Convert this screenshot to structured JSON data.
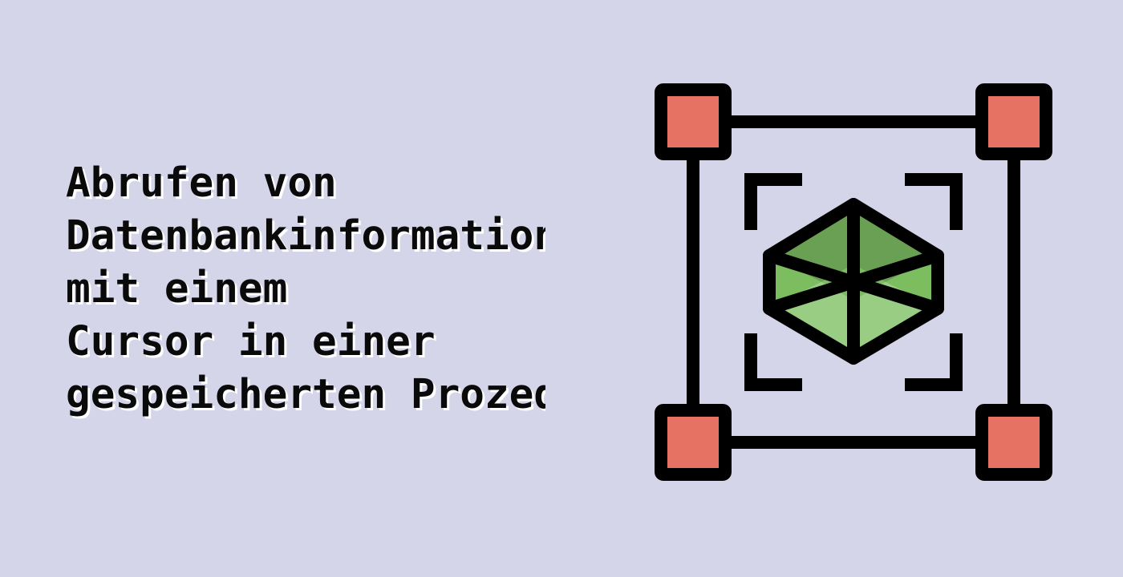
{
  "title": {
    "lines": [
      "Abrufen von",
      "Datenbankinformationen",
      "mit einem",
      "Cursor in einer",
      "gespeicherten Prozedur"
    ]
  },
  "illustration": {
    "icon": "3d-cube-in-selection-frame-icon",
    "colors": {
      "background": "#d4d5e8",
      "outline": "#000000",
      "corner_handle": "#e57262",
      "cube_dark": "#6aa053",
      "cube_mid": "#7bbd5f",
      "cube_light": "#99cd83"
    }
  }
}
